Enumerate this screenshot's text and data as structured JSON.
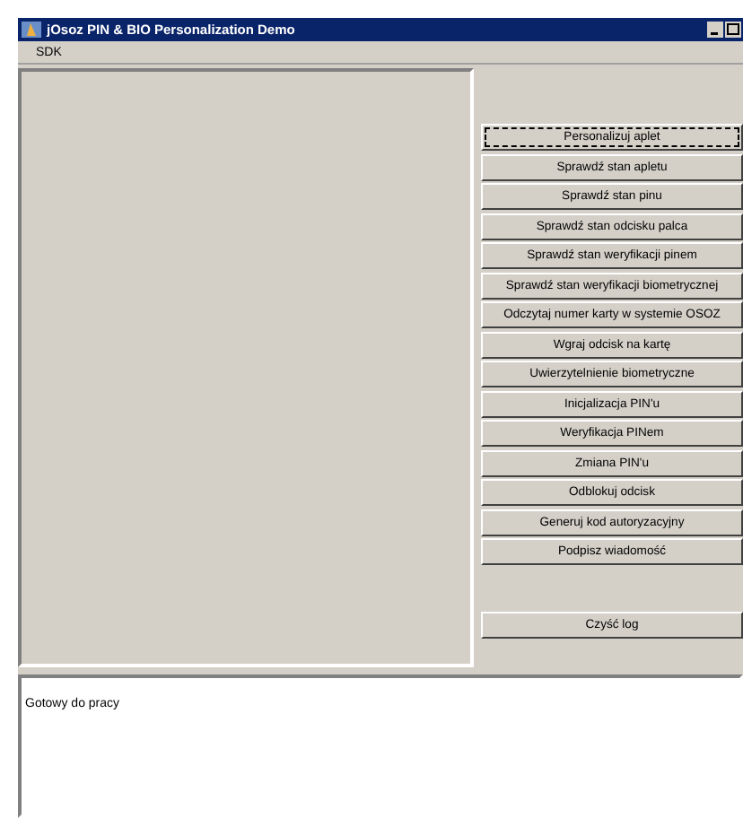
{
  "window": {
    "title": "jOsoz PIN & BIO Personalization Demo"
  },
  "menu": [
    {
      "label": "SDK"
    }
  ],
  "buttons": [
    {
      "label": "Personalizuj aplet",
      "focused": true
    },
    {
      "label": "Sprawdź stan apletu",
      "focused": false
    },
    {
      "label": "Sprawdź stan pinu",
      "focused": false
    },
    {
      "label": "Sprawdź stan odcisku palca",
      "focused": false
    },
    {
      "label": "Sprawdź stan weryfikacji pinem",
      "focused": false
    },
    {
      "label": "Sprawdź stan weryfikacji biometrycznej",
      "focused": false
    },
    {
      "label": "Odczytaj numer karty w systemie OSOZ",
      "focused": false
    },
    {
      "label": "Wgraj odcisk na kartę",
      "focused": false
    },
    {
      "label": "Uwierzytelnienie biometryczne",
      "focused": false
    },
    {
      "label": "Inicjalizacja PIN'u",
      "focused": false
    },
    {
      "label": "Weryfikacja PINem",
      "focused": false
    },
    {
      "label": "Zmiana PIN'u",
      "focused": false
    },
    {
      "label": "Odblokuj odcisk",
      "focused": false
    },
    {
      "label": "Generuj kod autoryzacyjny",
      "focused": false
    },
    {
      "label": "Podpisz wiadomość",
      "focused": false
    }
  ],
  "clear_button": {
    "label": "Czyść log",
    "focused": false
  },
  "log": {
    "text": "Gotowy do pracy"
  }
}
